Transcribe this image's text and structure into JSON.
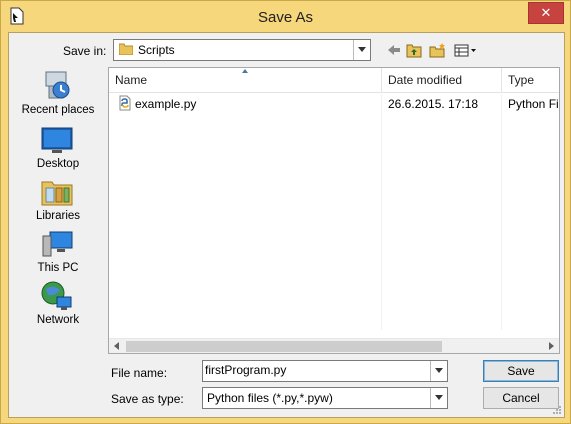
{
  "window": {
    "title": "Save As",
    "close_glyph": "✕"
  },
  "toolbar": {
    "save_in_label": "Save in:",
    "save_in_value": "Scripts",
    "icons": [
      "back-arrow-icon",
      "up-folder-icon",
      "new-folder-icon",
      "view-menu-icon"
    ]
  },
  "places": [
    {
      "label": "Recent places",
      "icon": "recent-places-icon"
    },
    {
      "label": "Desktop",
      "icon": "desktop-icon"
    },
    {
      "label": "Libraries",
      "icon": "libraries-icon"
    },
    {
      "label": "This PC",
      "icon": "this-pc-icon"
    },
    {
      "label": "Network",
      "icon": "network-icon"
    }
  ],
  "filelist": {
    "columns": [
      "Name",
      "Date modified",
      "Type"
    ],
    "rows": [
      {
        "name": "example.py",
        "date": "26.6.2015. 17:18",
        "type": "Python Fil"
      }
    ]
  },
  "form": {
    "file_name_label": "File name:",
    "file_name_value": "firstProgram.py",
    "save_as_type_label": "Save as type:",
    "save_as_type_value": "Python files (*.py,*.pyw)"
  },
  "buttons": {
    "save": "Save",
    "cancel": "Cancel"
  },
  "colors": {
    "frame": "#f7d77b",
    "close": "#c7433f",
    "accent": "#3c7fb1"
  }
}
